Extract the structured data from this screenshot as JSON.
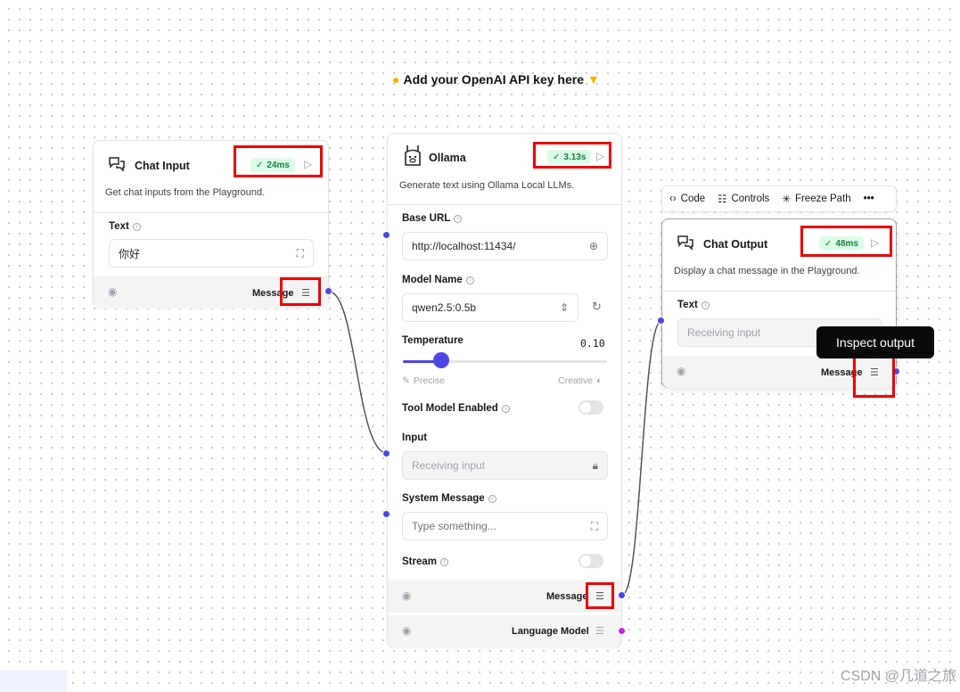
{
  "note": {
    "text": "Add your OpenAI API key here",
    "bulb_icon": "lightbulb-icon",
    "hand_icon": "pointing-down-icon"
  },
  "chat_input": {
    "title": "Chat Input",
    "time": "24ms",
    "description": "Get chat inputs from the Playground.",
    "text_label": "Text",
    "text_value": "你好",
    "output_label": "Message"
  },
  "ollama": {
    "title": "Ollama",
    "time": "3.13s",
    "description": "Generate text using Ollama Local LLMs.",
    "base_url_label": "Base URL",
    "base_url_value": "http://localhost:11434/",
    "model_name_label": "Model Name",
    "model_name_value": "qwen2.5:0.5b",
    "temperature_label": "Temperature",
    "temperature_value": "0.10",
    "temperature_fraction": 0.1,
    "precise_label": "Precise",
    "creative_label": "Creative",
    "tool_model_label": "Tool Model Enabled",
    "input_label": "Input",
    "input_placeholder": "Receiving input",
    "system_message_label": "System Message",
    "system_message_placeholder": "Type something...",
    "stream_label": "Stream",
    "output_message_label": "Message",
    "output_model_label": "Language Model"
  },
  "chat_output": {
    "title": "Chat Output",
    "time": "48ms",
    "description": "Display a chat message in the Playground.",
    "text_label": "Text",
    "text_placeholder": "Receiving input",
    "output_label": "Message"
  },
  "toolbar": {
    "code": "Code",
    "controls": "Controls",
    "freeze_path": "Freeze Path",
    "more": "•••"
  },
  "tooltip": {
    "text": "Inspect output"
  },
  "watermark": "CSDN @几道之旅",
  "colors": {
    "handle": "#4f46e5",
    "handle_model": "#c026d3",
    "success_bg": "#dcfce7",
    "success_fg": "#15803d",
    "highlight": "#ee0000"
  }
}
